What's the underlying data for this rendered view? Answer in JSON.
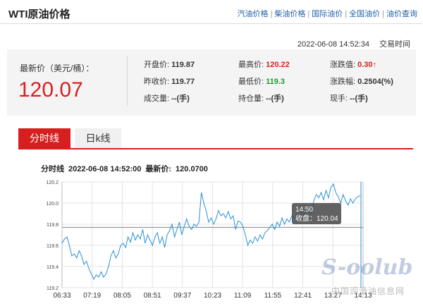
{
  "header": {
    "title": "WTI原油价格",
    "nav": [
      "汽油价格",
      "柴油价格",
      "国际油价",
      "全国油价",
      "油价查询"
    ]
  },
  "quote": {
    "timestamp": "2022-06-08 14:52:34",
    "time_label": "交易时间",
    "price_label": "最新价（美元/桶）：",
    "price": "120.07",
    "stats": {
      "open_label": "开盘价:",
      "open": "119.87",
      "high_label": "最高价:",
      "high": "120.22",
      "change_label": "涨跌值:",
      "change": "0.30↑",
      "prev_close_label": "昨收价:",
      "prev_close": "119.77",
      "low_label": "最低价:",
      "low": "119.3",
      "change_pct_label": "涨跌幅:",
      "change_pct": "0.2504(%)",
      "volume_label": "成交量:",
      "volume": "--(手)",
      "open_interest_label": "持仓量:",
      "open_interest": "--(手)",
      "current_hand_label": "现手:",
      "current_hand": "--(手)"
    }
  },
  "tabs": [
    "分时线",
    "日k线"
  ],
  "chart_info": {
    "label": "分时线",
    "time": "2022-06-08 14:52:00",
    "latest_label": "最新价:",
    "latest": "120.0700"
  },
  "chart_data": {
    "type": "line",
    "yticks": [
      "120.2",
      "120.0",
      "119.8",
      "119.6",
      "119.4",
      "119.2"
    ],
    "ylim": [
      119.2,
      120.2
    ],
    "xticks": [
      "06:33",
      "07:19",
      "08:05",
      "08:51",
      "09:37",
      "10:23",
      "11:09",
      "11:55",
      "12:41",
      "13:27",
      "14:13"
    ],
    "reference": 119.77,
    "tooltip": {
      "time": "14:50",
      "label": "收盘：120.04"
    },
    "series": [
      {
        "values": [
          119.62,
          119.66,
          119.68,
          119.6,
          119.5,
          119.52,
          119.48,
          119.55,
          119.5,
          119.42,
          119.45,
          119.38,
          119.33,
          119.28,
          119.32,
          119.3,
          119.35,
          119.3,
          119.33,
          119.4,
          119.5,
          119.55,
          119.48,
          119.52,
          119.6,
          119.62,
          119.58,
          119.68,
          119.63,
          119.72,
          119.65,
          119.7,
          119.66,
          119.75,
          119.62,
          119.7,
          119.65,
          119.6,
          119.68,
          119.72,
          119.62,
          119.68,
          119.58,
          119.7,
          119.74,
          119.8,
          119.68,
          119.75,
          119.82,
          119.7,
          119.78,
          119.85,
          119.78,
          119.75,
          119.8,
          119.78,
          119.82,
          120.1,
          120.0,
          119.92,
          119.82,
          119.86,
          119.8,
          119.85,
          119.93,
          119.88,
          119.9,
          119.86,
          119.92,
          119.85,
          119.88,
          119.75,
          119.83,
          119.82,
          119.78,
          119.7,
          119.6,
          119.65,
          119.62,
          119.68,
          119.64,
          119.7,
          119.66,
          119.72,
          119.74,
          119.77,
          119.8,
          119.75,
          119.82,
          119.78,
          119.86,
          119.8,
          119.85,
          119.82,
          119.88,
          119.86,
          119.9,
          119.85,
          119.93,
          119.88,
          119.95,
          119.92,
          119.9,
          120.02,
          120.08,
          120.05,
          120.1,
          120.03,
          120.12,
          120.05,
          120.15,
          120.18,
          120.1,
          120.06,
          120.0,
          120.08,
          120.02,
          119.98,
          120.04,
          120.0,
          120.04,
          120.06,
          120.07
        ]
      }
    ]
  },
  "watermark": {
    "logo": "S-oolub",
    "site": "中国润滑油信息网"
  }
}
